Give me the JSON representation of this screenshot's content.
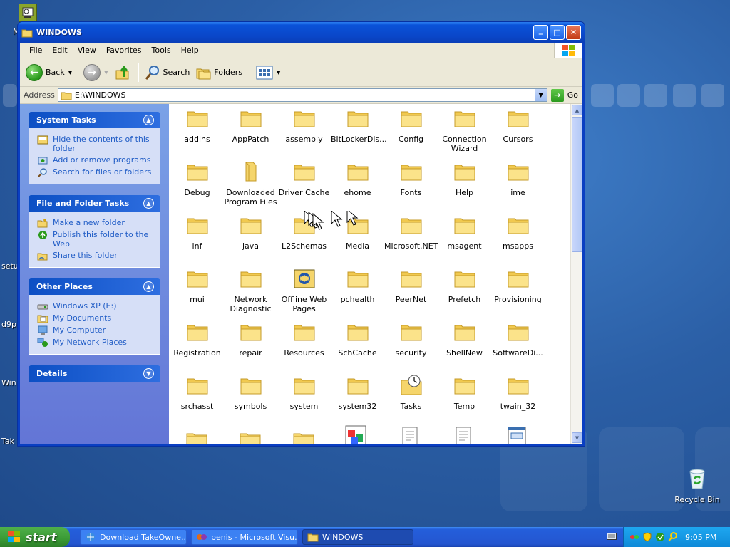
{
  "window": {
    "title": "WINDOWS",
    "controls": {
      "minimize": "_",
      "maximize": "□",
      "close": "✕"
    }
  },
  "menu": [
    "File",
    "Edit",
    "View",
    "Favorites",
    "Tools",
    "Help"
  ],
  "toolbar": {
    "back_label": "Back",
    "search_label": "Search",
    "folders_label": "Folders"
  },
  "address": {
    "label": "Address",
    "value": "E:\\WINDOWS",
    "go_label": "Go"
  },
  "taskpane": {
    "system_tasks": {
      "title": "System Tasks",
      "items": [
        "Hide the contents of this folder",
        "Add or remove programs",
        "Search for files or folders"
      ]
    },
    "file_folder_tasks": {
      "title": "File and Folder Tasks",
      "items": [
        "Make a new folder",
        "Publish this folder to the Web",
        "Share this folder"
      ]
    },
    "other_places": {
      "title": "Other Places",
      "items": [
        "Windows XP (E:)",
        "My Documents",
        "My Computer",
        "My Network Places"
      ]
    },
    "details": {
      "title": "Details"
    }
  },
  "files": [
    "addins",
    "AppPatch",
    "assembly",
    "BitLockerDis...",
    "Config",
    "Connection Wizard",
    "Cursors",
    "Debug",
    "Downloaded Program Files",
    "Driver Cache",
    "ehome",
    "Fonts",
    "Help",
    "ime",
    "inf",
    "java",
    "L2Schemas",
    "Media",
    "Microsoft.NET",
    "msagent",
    "msapps",
    "mui",
    "Network Diagnostic",
    "Offline Web Pages",
    "pchealth",
    "PeerNet",
    "Prefetch",
    "Provisioning",
    "Registration",
    "repair",
    "Resources",
    "SchCache",
    "security",
    "ShellNew",
    "SoftwareDi...",
    "srchasst",
    "symbols",
    "system",
    "system32",
    "Tasks",
    "Temp",
    "twain_32"
  ],
  "desktop": {
    "labels": [
      "M",
      "setu",
      "d9p",
      "Win",
      "Tak"
    ],
    "recycle_bin": "Recycle Bin"
  },
  "taskbar": {
    "start_label": "start",
    "buttons": [
      "Download TakeOwne...",
      "penis - Microsoft Visu...",
      "WINDOWS"
    ],
    "clock": "9:05 PM"
  },
  "colors": {
    "title_blue": "#0a46c8",
    "taskpane_blue": "#6e8ce0",
    "start_green": "#3a9a35",
    "link_blue": "#215dc6"
  }
}
